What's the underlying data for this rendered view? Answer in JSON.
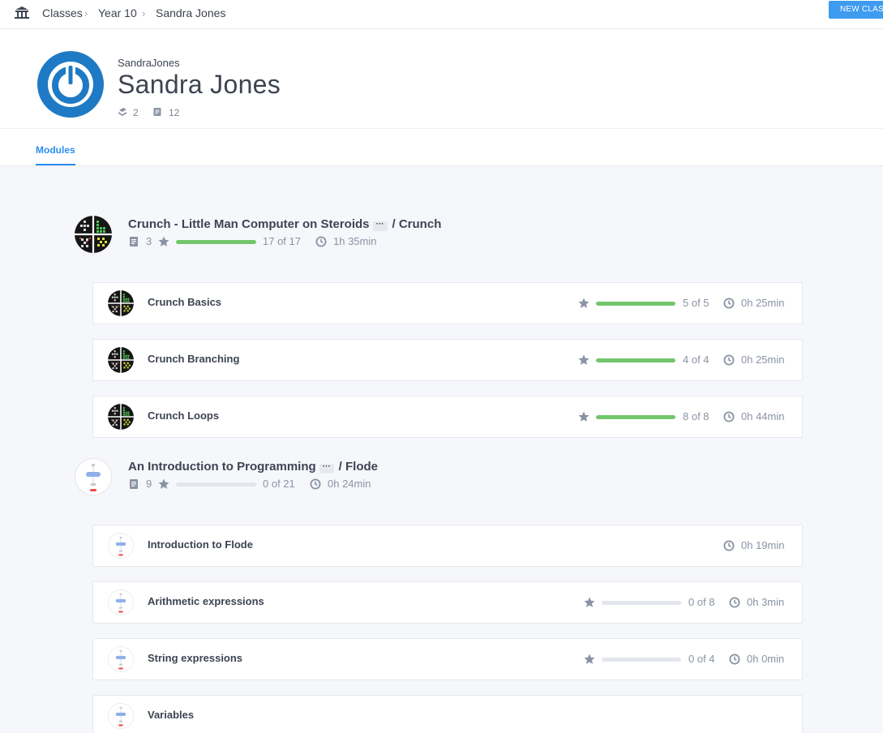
{
  "breadcrumb": {
    "home_icon": "bank-icon",
    "items": [
      "Classes",
      "Year 10",
      "Sandra Jones"
    ]
  },
  "toolbar": {
    "new_class_label": "NEW CLASS"
  },
  "profile": {
    "username": "SandraJones",
    "full_name": "Sandra Jones",
    "stats": [
      {
        "icon": "modules-icon",
        "value": "2"
      },
      {
        "icon": "pages-icon",
        "value": "12"
      }
    ]
  },
  "tabs": [
    {
      "label": "Modules",
      "active": true
    }
  ],
  "colors": {
    "accent": "#2b8ff0",
    "progress": "#72c66c",
    "track": "#e3e6ec",
    "button": "#3d9bf0"
  },
  "modules": [
    {
      "title": "Crunch - Little Man Computer on Steroids",
      "more_label": "···",
      "subject": "/ Crunch",
      "icon": "crunch-icon",
      "pages": "3",
      "progress_fraction": 1.0,
      "progress_label": "17 of 17",
      "duration": "1h 35min",
      "lessons": [
        {
          "title": "Crunch Basics",
          "progress_fraction": 1.0,
          "progress_label": "5 of 5",
          "duration": "0h 25min",
          "has_progress": true
        },
        {
          "title": "Crunch Branching",
          "progress_fraction": 1.0,
          "progress_label": "4 of 4",
          "duration": "0h 25min",
          "has_progress": true
        },
        {
          "title": "Crunch Loops",
          "progress_fraction": 1.0,
          "progress_label": "8 of 8",
          "duration": "0h 44min",
          "has_progress": true
        }
      ]
    },
    {
      "title": "An Introduction to Programming",
      "more_label": "···",
      "subject": "/ Flode",
      "icon": "flode-icon",
      "pages": "9",
      "progress_fraction": 0,
      "progress_label": "0 of 21",
      "duration": "0h 24min",
      "lessons": [
        {
          "title": "Introduction to Flode",
          "duration": "0h 19min",
          "has_progress": false
        },
        {
          "title": "Arithmetic expressions",
          "progress_fraction": 0,
          "progress_label": "0 of 8",
          "duration": "0h 3min",
          "has_progress": true
        },
        {
          "title": "String expressions",
          "progress_fraction": 0,
          "progress_label": "0 of 4",
          "duration": "0h 0min",
          "has_progress": true
        },
        {
          "title": "Variables",
          "has_progress": false
        }
      ]
    }
  ]
}
